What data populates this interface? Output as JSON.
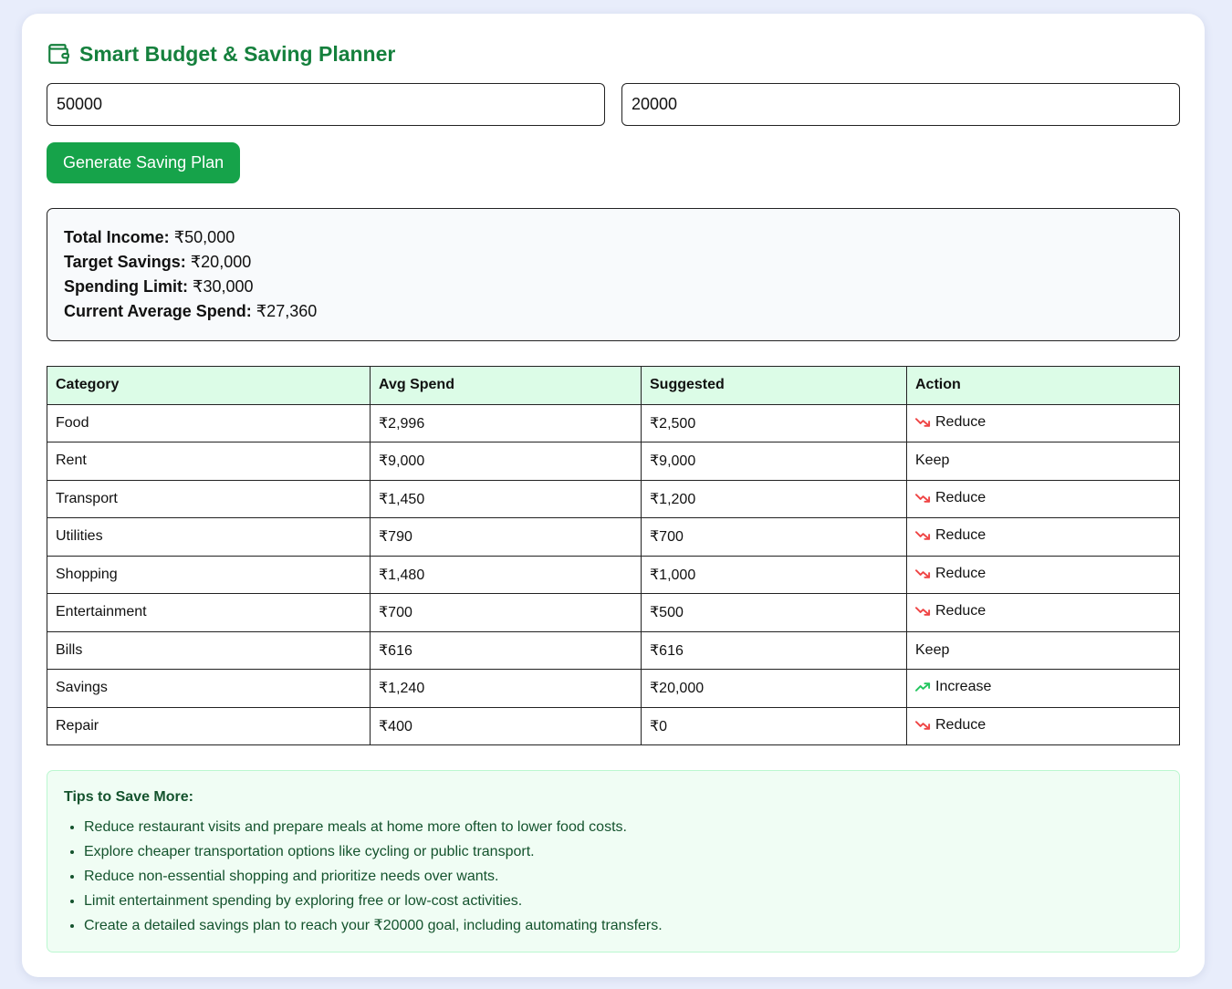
{
  "app": {
    "title": "Smart Budget & Saving Planner",
    "icon": "wallet-icon"
  },
  "inputs": {
    "income_value": "50000",
    "savings_value": "20000"
  },
  "button": {
    "generate_label": "Generate Saving Plan"
  },
  "summary": {
    "income_label": "Total Income:",
    "income_value": "₹50,000",
    "target_label": "Target Savings:",
    "target_value": "₹20,000",
    "limit_label": "Spending Limit:",
    "limit_value": "₹30,000",
    "avg_label": "Current Average Spend:",
    "avg_value": "₹27,360"
  },
  "table": {
    "headers": [
      "Category",
      "Avg Spend",
      "Suggested",
      "Action"
    ],
    "rows": [
      {
        "category": "Food",
        "avg": "₹2,996",
        "suggested": "₹2,500",
        "action": "Reduce",
        "icon": "trend-down-icon"
      },
      {
        "category": "Rent",
        "avg": "₹9,000",
        "suggested": "₹9,000",
        "action": "Keep",
        "icon": ""
      },
      {
        "category": "Transport",
        "avg": "₹1,450",
        "suggested": "₹1,200",
        "action": "Reduce",
        "icon": "trend-down-icon"
      },
      {
        "category": "Utilities",
        "avg": "₹790",
        "suggested": "₹700",
        "action": "Reduce",
        "icon": "trend-down-icon"
      },
      {
        "category": "Shopping",
        "avg": "₹1,480",
        "suggested": "₹1,000",
        "action": "Reduce",
        "icon": "trend-down-icon"
      },
      {
        "category": "Entertainment",
        "avg": "₹700",
        "suggested": "₹500",
        "action": "Reduce",
        "icon": "trend-down-icon"
      },
      {
        "category": "Bills",
        "avg": "₹616",
        "suggested": "₹616",
        "action": "Keep",
        "icon": ""
      },
      {
        "category": "Savings",
        "avg": "₹1,240",
        "suggested": "₹20,000",
        "action": "Increase",
        "icon": "trend-up-icon"
      },
      {
        "category": "Repair",
        "avg": "₹400",
        "suggested": "₹0",
        "action": "Reduce",
        "icon": "trend-down-icon"
      }
    ]
  },
  "tips": {
    "title": "Tips to Save More:",
    "items": [
      "Reduce restaurant visits and prepare meals at home more often to lower food costs.",
      "Explore cheaper transportation options like cycling or public transport.",
      "Reduce non-essential shopping and prioritize needs over wants.",
      "Limit entertainment spending by exploring free or low-cost activities.",
      "Create a detailed savings plan to reach your ₹20000 goal, including automating transfers."
    ]
  },
  "colors": {
    "brand": "#15803d",
    "button": "#16a34a",
    "down": "#ef4444",
    "up": "#22c55e"
  }
}
